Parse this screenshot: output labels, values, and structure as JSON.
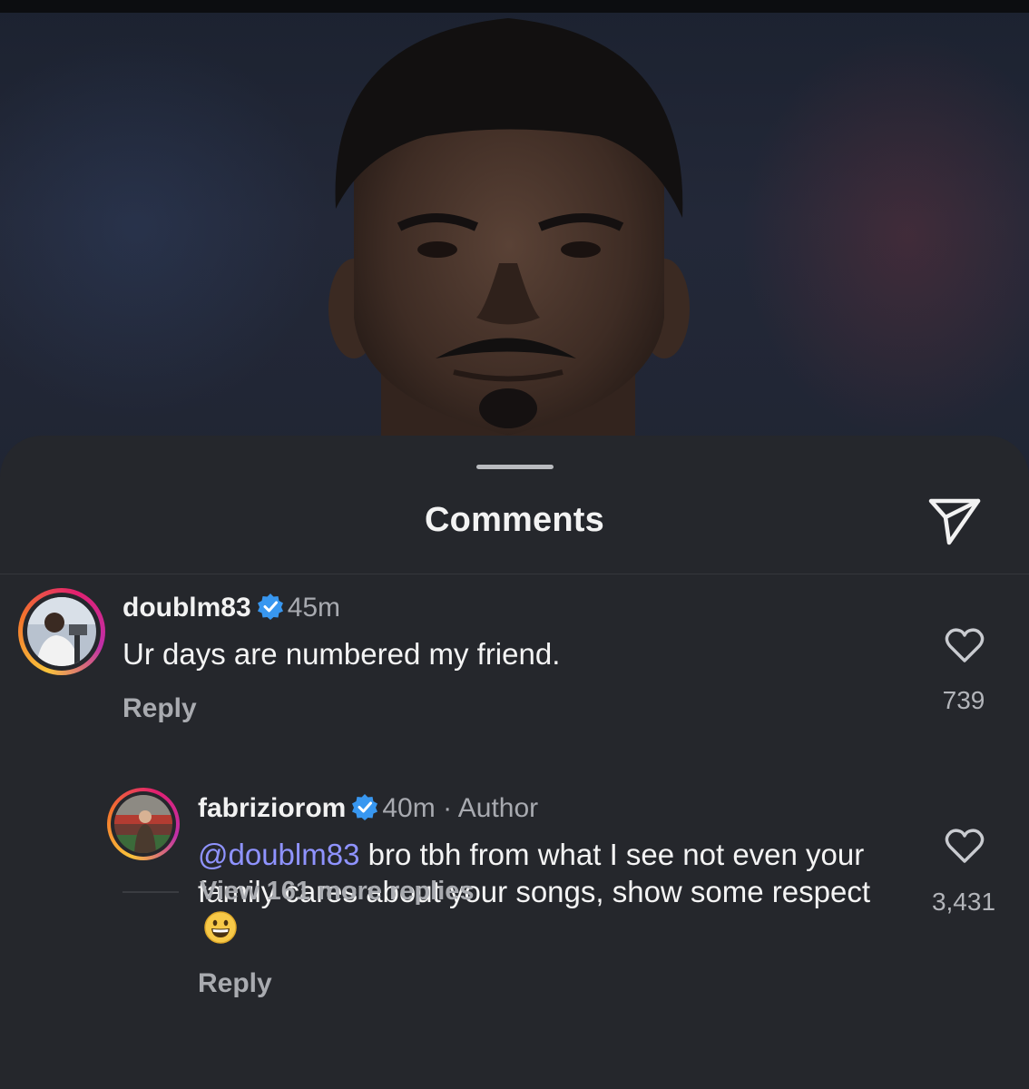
{
  "sheet": {
    "title": "Comments"
  },
  "comments": [
    {
      "username": "doublm83",
      "time": "45m",
      "text": "Ur days are numbered my friend.",
      "reply_label": "Reply",
      "likes": "739"
    }
  ],
  "replies": [
    {
      "username": "fabriziorom",
      "time": "40m",
      "separator": "·",
      "author_label": "Author",
      "mention": "@doublm83",
      "text": " bro tbh from what I see not even your family cares about your songs, show some respect",
      "reply_label": "Reply",
      "likes": "3,431"
    }
  ],
  "thread": {
    "view_more_label": "View 161 more replies"
  },
  "icons": {
    "share": "paper-plane-icon",
    "like": "heart-outline-icon",
    "verified": "verified-badge-icon",
    "emoji": "grinning-face-emoji"
  },
  "colors": {
    "background": "#25272c",
    "mention": "#8f93ff",
    "verified": "#3897f0",
    "secondary_text": "#a9abb0"
  }
}
